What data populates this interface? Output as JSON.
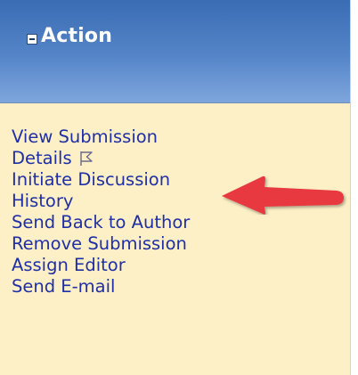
{
  "panel": {
    "title": "Action",
    "toggle_icon": "collapse-minus-icon",
    "header_color": "#4a7bc0",
    "background_color": "#fdf0c6"
  },
  "actions": [
    {
      "label": "View Submission"
    },
    {
      "label": "Details",
      "icon": "flag-outline-icon"
    },
    {
      "label": "Initiate Discussion"
    },
    {
      "label": "History"
    },
    {
      "label": "Send Back to Author"
    },
    {
      "label": "Remove Submission"
    },
    {
      "label": "Assign Editor"
    },
    {
      "label": "Send E-mail"
    }
  ],
  "annotation": {
    "icon": "red-arrow-left-icon",
    "color": "#e8383f",
    "points_to": "Initiate Discussion"
  },
  "link_color": "#1f2fa8"
}
